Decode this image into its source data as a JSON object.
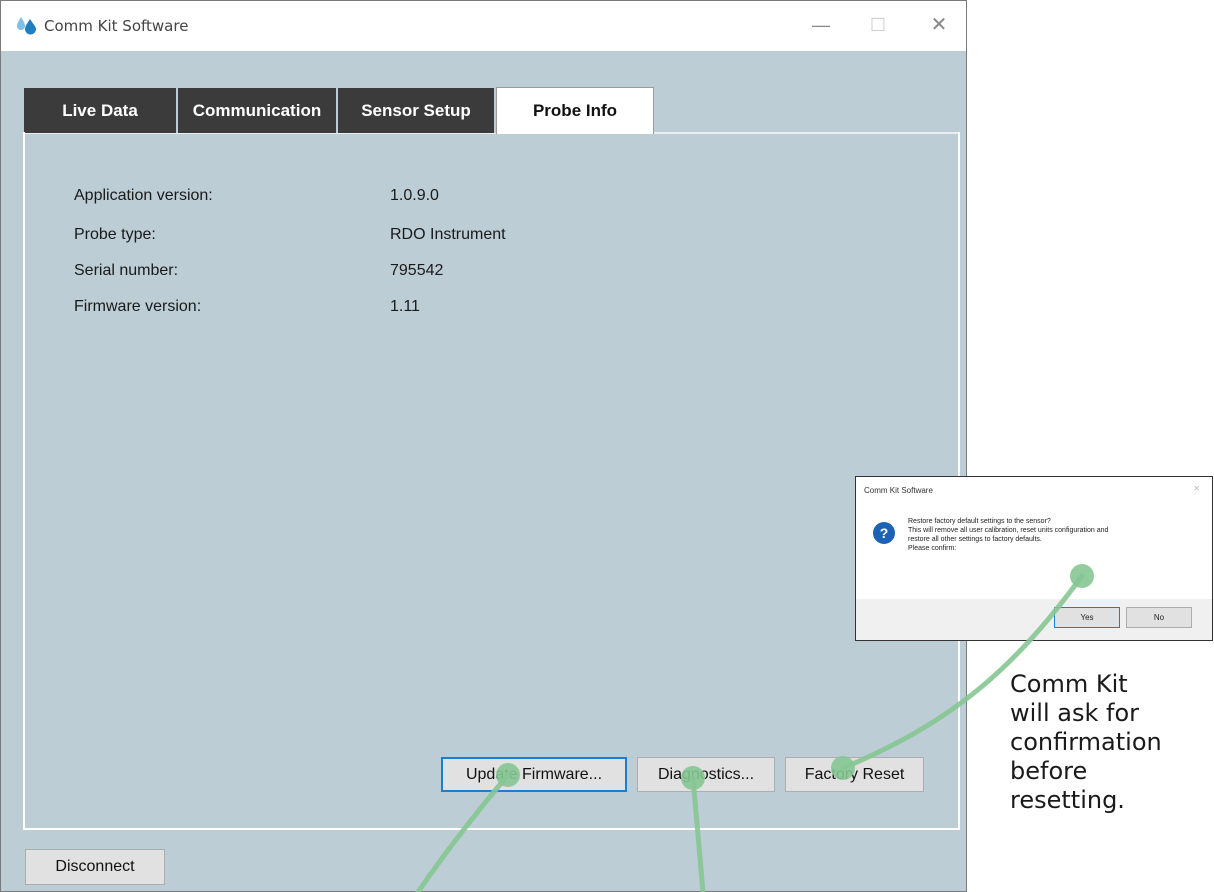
{
  "window": {
    "title": "Comm Kit Software",
    "controls": {
      "minimize": "—",
      "maximize": "☐",
      "close": "✕"
    }
  },
  "tabs": [
    {
      "label": "Live Data",
      "active": false
    },
    {
      "label": "Communication",
      "active": false
    },
    {
      "label": "Sensor Setup",
      "active": false
    },
    {
      "label": "Probe Info",
      "active": true
    }
  ],
  "probe_info": [
    {
      "label": "Application version:",
      "value": "1.0.9.0"
    },
    {
      "label": "Probe type:",
      "value": "RDO Instrument"
    },
    {
      "label": "Serial number:",
      "value": "795542"
    },
    {
      "label": "Firmware version:",
      "value": "1.11"
    }
  ],
  "buttons": {
    "update_firmware": "Update Firmware...",
    "diagnostics": "Diagnostics...",
    "factory_reset": "Factory Reset",
    "disconnect": "Disconnect"
  },
  "dialog": {
    "title": "Comm Kit Software",
    "close": "✕",
    "icon": "?",
    "message_lines": [
      "Restore factory default settings to the sensor?",
      "This will remove all user calibration, reset units configuration and",
      "restore all other settings to factory defaults.",
      "Please confirm:"
    ],
    "yes": "Yes",
    "no": "No"
  },
  "callout": {
    "lines": [
      "Comm Kit",
      "will ask for",
      "confirmation",
      "before",
      "resetting."
    ]
  },
  "colors": {
    "window_bg": "#bccdd5",
    "tab_dark": "#3b3b3b",
    "callout_line": "#86c694",
    "accent_blue": "#1b7fd0"
  }
}
